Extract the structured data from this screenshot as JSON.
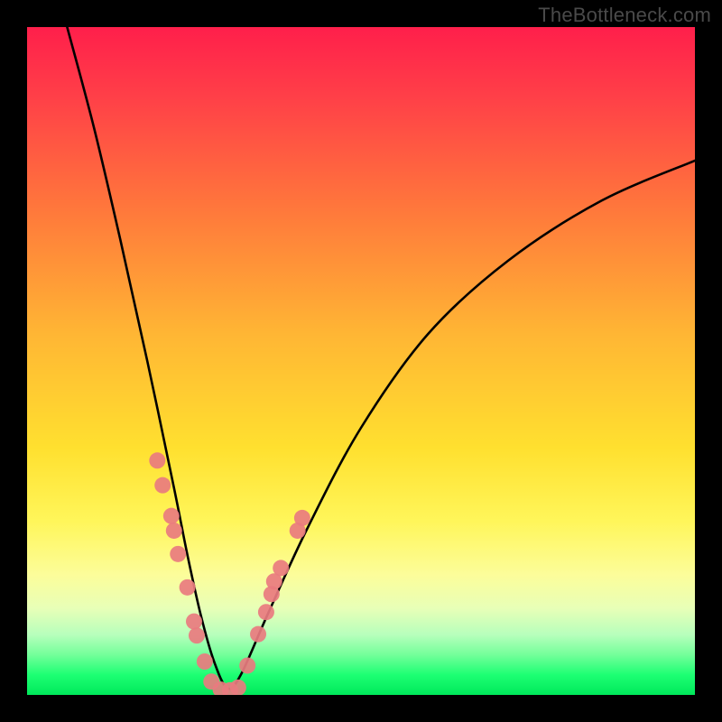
{
  "watermark": "TheBottleneck.com",
  "chart_data": {
    "type": "line",
    "title": "",
    "xlabel": "",
    "ylabel": "",
    "xlim": [
      0,
      100
    ],
    "ylim": [
      0,
      100
    ],
    "gradient_stops": [
      {
        "pos": 0,
        "color": "#ff1f4b"
      },
      {
        "pos": 10,
        "color": "#ff3e48"
      },
      {
        "pos": 28,
        "color": "#ff7a3b"
      },
      {
        "pos": 46,
        "color": "#ffb634"
      },
      {
        "pos": 63,
        "color": "#ffe02f"
      },
      {
        "pos": 74,
        "color": "#fff65a"
      },
      {
        "pos": 82,
        "color": "#fcfd9a"
      },
      {
        "pos": 87,
        "color": "#e8ffb7"
      },
      {
        "pos": 91,
        "color": "#b7ffbc"
      },
      {
        "pos": 94,
        "color": "#73ff9a"
      },
      {
        "pos": 97,
        "color": "#1dff73"
      },
      {
        "pos": 100,
        "color": "#00e85a"
      }
    ],
    "series": [
      {
        "name": "bottleneck-curve",
        "x": [
          6,
          10,
          14,
          18,
          22,
          24,
          26,
          28,
          30,
          32,
          36,
          42,
          50,
          60,
          72,
          86,
          100
        ],
        "y": [
          100,
          85,
          68,
          50,
          31,
          21,
          12,
          5,
          1,
          3,
          12,
          25,
          40,
          54,
          65,
          74,
          80
        ]
      }
    ],
    "markers": {
      "name": "highlighted-points",
      "color": "#e97b7f",
      "points": [
        {
          "x": 19.5,
          "y": 35.1
        },
        {
          "x": 20.3,
          "y": 31.4
        },
        {
          "x": 21.6,
          "y": 26.8
        },
        {
          "x": 22.0,
          "y": 24.6
        },
        {
          "x": 22.6,
          "y": 21.1
        },
        {
          "x": 24.0,
          "y": 16.1
        },
        {
          "x": 25.0,
          "y": 11.0
        },
        {
          "x": 25.4,
          "y": 8.9
        },
        {
          "x": 26.6,
          "y": 5.0
        },
        {
          "x": 27.6,
          "y": 2.0
        },
        {
          "x": 29.0,
          "y": 0.8
        },
        {
          "x": 30.4,
          "y": 0.7
        },
        {
          "x": 31.6,
          "y": 1.1
        },
        {
          "x": 33.0,
          "y": 4.4
        },
        {
          "x": 34.6,
          "y": 9.1
        },
        {
          "x": 35.8,
          "y": 12.4
        },
        {
          "x": 36.6,
          "y": 15.1
        },
        {
          "x": 37.0,
          "y": 17.0
        },
        {
          "x": 38.0,
          "y": 19.0
        },
        {
          "x": 40.5,
          "y": 24.6
        },
        {
          "x": 41.2,
          "y": 26.5
        }
      ]
    }
  }
}
